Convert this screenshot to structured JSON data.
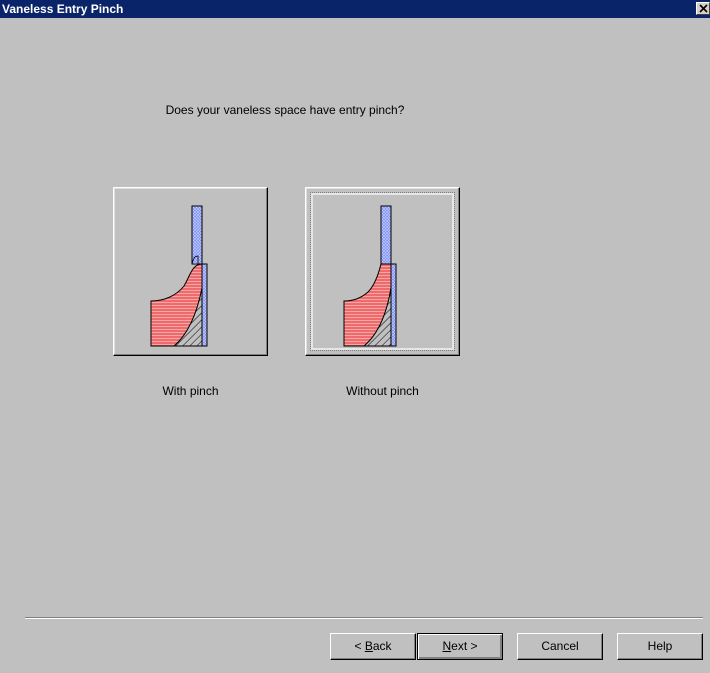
{
  "window": {
    "title": "Vaneless Entry Pinch"
  },
  "question": "Does your vaneless space have entry pinch?",
  "options": [
    {
      "label": "With pinch",
      "icon": "impeller-with-pinch-diagram",
      "selected": false
    },
    {
      "label": "Without pinch",
      "icon": "impeller-without-pinch-diagram",
      "selected": true
    }
  ],
  "buttons": {
    "back": {
      "prefix": "< ",
      "mnemonic": "B",
      "rest": "ack"
    },
    "next": {
      "mnemonic": "N",
      "rest": "ext >"
    },
    "cancel": "Cancel",
    "help": "Help"
  },
  "colors": {
    "titlebar": "#0a246a",
    "impeller": "#ef6b6b",
    "diffuser": "#7b8fef",
    "face": "#c0c0c0"
  }
}
